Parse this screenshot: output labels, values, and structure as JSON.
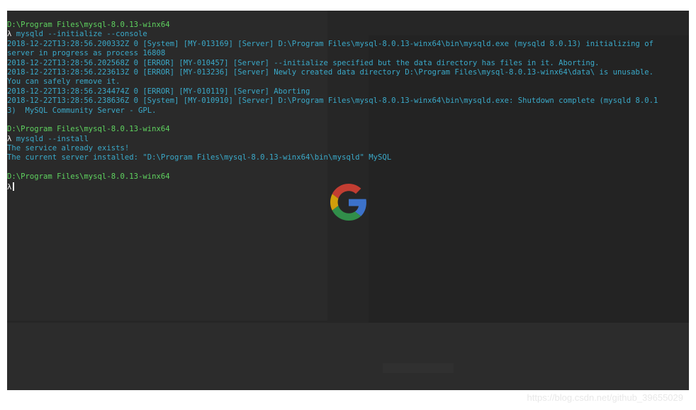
{
  "terminal": {
    "lines": [
      {
        "kind": "path",
        "text": "D:\\Program Files\\mysql-8.0.13-winx64"
      },
      {
        "kind": "cmd",
        "prompt": "λ",
        "text": " mysqld --initialize --console"
      },
      {
        "kind": "out",
        "text": "2018-12-22T13:28:56.200332Z 0 [System] [MY-013169] [Server] D:\\Program Files\\mysql-8.0.13-winx64\\bin\\mysqld.exe (mysqld 8.0.13) initializing of"
      },
      {
        "kind": "out",
        "text": "server in progress as process 16808"
      },
      {
        "kind": "out",
        "text": "2018-12-22T13:28:56.202568Z 0 [ERROR] [MY-010457] [Server] --initialize specified but the data directory has files in it. Aborting."
      },
      {
        "kind": "out",
        "text": "2018-12-22T13:28:56.223613Z 0 [ERROR] [MY-013236] [Server] Newly created data directory D:\\Program Files\\mysql-8.0.13-winx64\\data\\ is unusable."
      },
      {
        "kind": "out",
        "text": "You can safely remove it."
      },
      {
        "kind": "out",
        "text": "2018-12-22T13:28:56.234474Z 0 [ERROR] [MY-010119] [Server] Aborting"
      },
      {
        "kind": "out",
        "text": "2018-12-22T13:28:56.238636Z 0 [System] [MY-010910] [Server] D:\\Program Files\\mysql-8.0.13-winx64\\bin\\mysqld.exe: Shutdown complete (mysqld 8.0.1"
      },
      {
        "kind": "out",
        "text": "3)  MySQL Community Server - GPL."
      },
      {
        "kind": "blank",
        "text": ""
      },
      {
        "kind": "path",
        "text": "D:\\Program Files\\mysql-8.0.13-winx64"
      },
      {
        "kind": "cmd",
        "prompt": "λ",
        "text": " mysqld --install"
      },
      {
        "kind": "out",
        "text": "The service already exists!"
      },
      {
        "kind": "out",
        "text": "The current server installed: \"D:\\Program Files\\mysql-8.0.13-winx64\\bin\\mysqld\" MySQL"
      },
      {
        "kind": "blank",
        "text": ""
      },
      {
        "kind": "path",
        "text": "D:\\Program Files\\mysql-8.0.13-winx64"
      },
      {
        "kind": "input",
        "prompt": "λ",
        "text": ""
      }
    ]
  },
  "watermark": {
    "text": "https://blog.csdn.net/github_39655029"
  },
  "icons": {
    "logo": "google-g-icon"
  },
  "colors": {
    "background": "#262626",
    "path": "#5fd35f",
    "prompt": "#f2f2f2",
    "output": "#3aa9c9"
  }
}
